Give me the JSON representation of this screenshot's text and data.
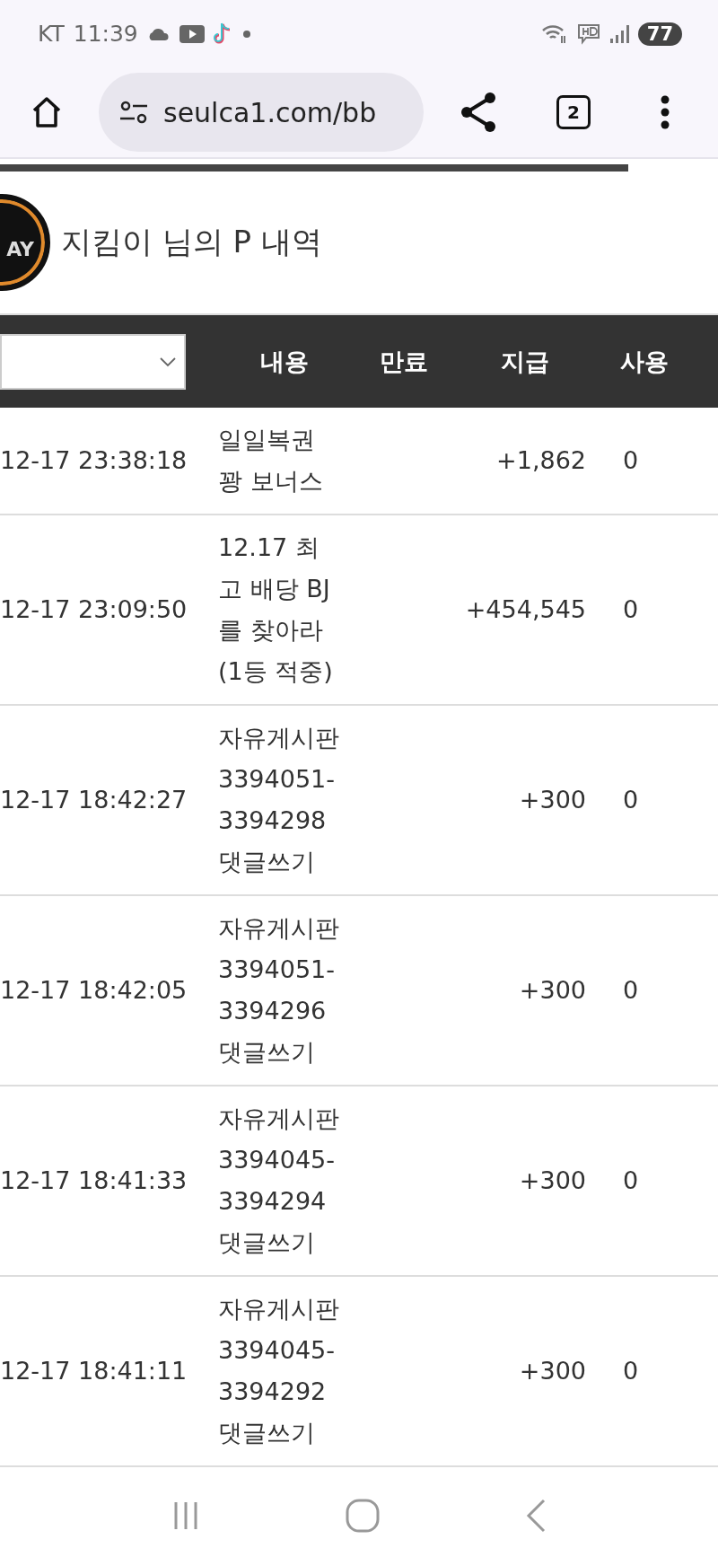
{
  "status_bar": {
    "carrier": "KT",
    "time": "11:39",
    "battery": "77"
  },
  "browser": {
    "url": "seulca1.com/bb",
    "tab_count": "2",
    "load_progress": {
      "level": 0.875
    }
  },
  "page": {
    "logo_text": "AY",
    "title": "지킴이 님의 P 내역"
  },
  "table": {
    "columns": [
      "내용",
      "만료",
      "지급",
      "사용"
    ],
    "rows": [
      {
        "date": "12-17 23:38:18",
        "content": "일일복권\n꽝 보너스",
        "expiry": "",
        "paid": "+1,862",
        "used": "0"
      },
      {
        "date": "12-17 23:09:50",
        "content": "12.17 최\n고 배당 BJ\n를 찾아라\n(1등 적중)",
        "expiry": "",
        "paid": "+454,545",
        "used": "0"
      },
      {
        "date": "12-17 18:42:27",
        "content": "자유게시판\n3394051-\n3394298\n댓글쓰기",
        "expiry": "",
        "paid": "+300",
        "used": "0"
      },
      {
        "date": "12-17 18:42:05",
        "content": "자유게시판\n3394051-\n3394296\n댓글쓰기",
        "expiry": "",
        "paid": "+300",
        "used": "0"
      },
      {
        "date": "12-17 18:41:33",
        "content": "자유게시판\n3394045-\n3394294\n댓글쓰기",
        "expiry": "",
        "paid": "+300",
        "used": "0"
      },
      {
        "date": "12-17 18:41:11",
        "content": "자유게시판\n3394045-\n3394292\n댓글쓰기",
        "expiry": "",
        "paid": "+300",
        "used": "0"
      }
    ]
  }
}
